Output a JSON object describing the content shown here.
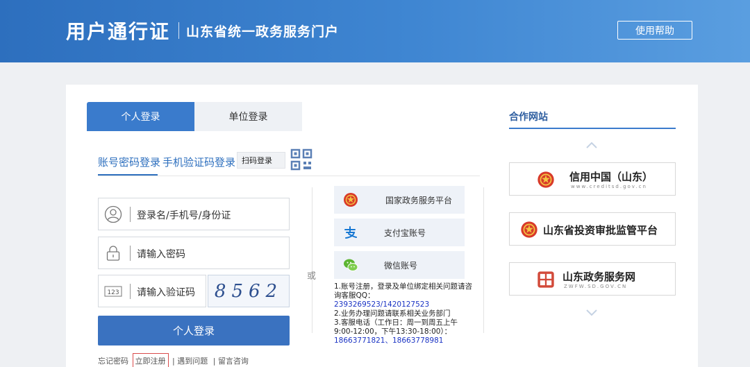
{
  "header": {
    "brand_main": "用户通行证",
    "brand_sub": "山东省统一政务服务门户",
    "help_label": "使用帮助"
  },
  "tabs": [
    {
      "label": "个人登录",
      "active": true
    },
    {
      "label": "单位登录",
      "active": false
    }
  ],
  "login_methods": {
    "account": "账号密码登录",
    "sms": "手机验证码登录",
    "scan": "扫码登录",
    "qr_icon": "qr-code-icon"
  },
  "form": {
    "username_placeholder": "登录名/手机号/身份证",
    "password_placeholder": "请输入密码",
    "captcha_placeholder": "请输入验证码",
    "captcha_code": "8562",
    "captcha_icon_text": "123",
    "submit_label": "个人登录"
  },
  "links": {
    "forgot": "忘记密码",
    "register": "立即注册",
    "problem": "遇到问题",
    "feedback": "留言咨询",
    "sep": "|"
  },
  "divider_or": "或",
  "third_party": [
    {
      "label": "国家政务服务平台",
      "icon": "national-emblem-icon"
    },
    {
      "label": "支付宝账号",
      "icon": "alipay-icon"
    },
    {
      "label": "微信账号",
      "icon": "wechat-icon"
    }
  ],
  "notes": {
    "line1": "1.账号注册，登录及单位绑定相关问题请咨询客服QQ：",
    "qq": "2393269523/1420127523",
    "line2": "2.业务办理问题请联系相关业务部门",
    "line3": "3.客服电话（工作日：周一到周五上午9:00-12:00，下午13:30-18:00）：",
    "phones": "18663771821、18663778981"
  },
  "partners": {
    "title": "合作网站",
    "items": [
      {
        "name": "信用中国（山东）",
        "sub": "www.creditsd.gov.cn"
      },
      {
        "name": "山东省投资审批监管平台",
        "sub": ""
      },
      {
        "name": "山东政务服务网",
        "sub": "ZWFW.SD.GOV.CN"
      }
    ]
  },
  "colors": {
    "primary": "#3a7bcc",
    "header_start": "#2d6fbe",
    "link_blue": "#1a33c4",
    "register_border": "#d94b4b"
  }
}
